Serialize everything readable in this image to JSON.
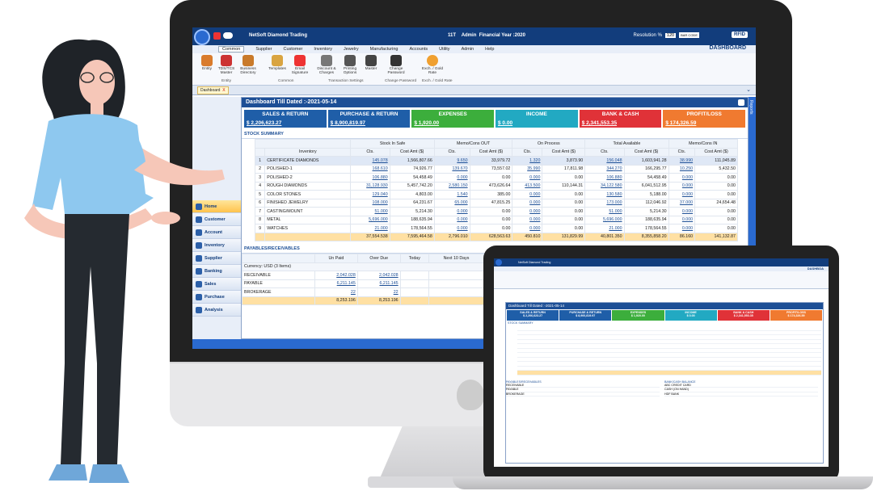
{
  "app": {
    "title": "NetSoft Diamond Trading",
    "user_info": "11T",
    "role": "Admin",
    "financial_year": "Financial Year :2020",
    "resolution_label": "Resolution %",
    "resolution_value": "120",
    "barcode_label": "BAR CODE",
    "rfid_label": "RFID",
    "dashboard_label": "DASHBOARD"
  },
  "menu": [
    "Common",
    "Supplier",
    "Customer",
    "Inventory",
    "Jewelry",
    "Manufacturing",
    "Accounts",
    "Utility",
    "Admin",
    "Help"
  ],
  "ribbon": {
    "items": [
      {
        "label": "Entity",
        "icon": "entity-icon"
      },
      {
        "label": "TDS/TCS Master",
        "icon": "tds-icon"
      },
      {
        "label": "Business Directory",
        "icon": "directory-icon"
      },
      {
        "label": "Templates",
        "icon": "templates-icon"
      },
      {
        "label": "Email Signature",
        "icon": "email-icon"
      },
      {
        "label": "Discount & Charges",
        "icon": "discount-icon"
      },
      {
        "label": "Printing Options",
        "icon": "printer-icon"
      },
      {
        "label": "Master",
        "icon": "master-icon"
      },
      {
        "label": "Change Password",
        "icon": "password-icon"
      },
      {
        "label": "Exch. / Gold Rate",
        "icon": "gold-rate-icon"
      }
    ],
    "groups": [
      "Entity",
      "Common",
      "Transaction Settings",
      "Change Password",
      "Exch. / Gold Rate"
    ]
  },
  "doc_tab": "Dashboard",
  "doc_tab_close": "X",
  "side_tab": "Reports",
  "nav": [
    "Home",
    "Customer",
    "Account",
    "Inventory",
    "Supplier",
    "Banking",
    "Sales",
    "Purchase",
    "Analysis"
  ],
  "dashboard": {
    "heading": "Dashboard Till Dated :-2021-05-14",
    "kpis": [
      {
        "title": "SALES & RETURN",
        "value": "$ 2,206,623.27",
        "color": "#1f5ea8"
      },
      {
        "title": "PURCHASE & RETURN",
        "value": "$ 8,900,819.97",
        "color": "#1f5ea8"
      },
      {
        "title": "EXPENSES",
        "value": "$ 1,920.00",
        "color": "#3cae3c"
      },
      {
        "title": "INCOME",
        "value": "$ 0.00",
        "color": "#22a9c2"
      },
      {
        "title": "BANK & CASH",
        "value": "$ 2,341,553.35",
        "color": "#e03238"
      },
      {
        "title": "PROFIT/LOSS",
        "value": "$ 174,326.59",
        "color": "#f07a30"
      }
    ],
    "stock_title": "STOCK SUMMARY",
    "stock_groups": [
      "Stock In Safe",
      "Memo/Cons OUT",
      "On Process",
      "Total Available",
      "Memo/Cons IN"
    ],
    "stock_subheads": [
      "Inventory",
      "Cts.",
      "Cost Amt ($)",
      "Cts.",
      "Cost Amt ($)",
      "Cts.",
      "Cost Amt ($)",
      "Cts.",
      "Cost Amt ($)",
      "Cts.",
      "Cost Amt ($)"
    ],
    "stock_rows": [
      [
        "1",
        "CERTIFICATE DIAMONDS",
        "145.078",
        "1,566,807.66",
        "9.650",
        "33,979.72",
        "1.320",
        "3,873.90",
        "156.048",
        "1,603,941.28",
        "38.990",
        "111,045.89"
      ],
      [
        "2",
        "POLISHED-1",
        "168.610",
        "74,926.77",
        "139.670",
        "73,557.02",
        "35.990",
        "17,811.98",
        "344.270",
        "166,295.77",
        "10.250",
        "5,432.50"
      ],
      [
        "3",
        "POLISHED-2",
        "106.880",
        "54,458.49",
        "0.000",
        "0.00",
        "0.000",
        "0.00",
        "106.880",
        "54,458.49",
        "0.000",
        "0.00"
      ],
      [
        "4",
        "ROUGH DIAMONDS",
        "31,128.930",
        "5,457,742.20",
        "2,580.150",
        "473,626.64",
        "413.500",
        "110,144.31",
        "34,122.580",
        "6,041,512.95",
        "0.000",
        "0.00"
      ],
      [
        "5",
        "COLOR STONES",
        "129.040",
        "4,803.00",
        "1.540",
        "385.00",
        "0.000",
        "0.00",
        "130.580",
        "5,188.00",
        "0.000",
        "0.00"
      ],
      [
        "6",
        "FINISHED JEWELRY",
        "108.000",
        "64,231.67",
        "65.000",
        "47,815.25",
        "0.000",
        "0.00",
        "173.000",
        "112,046.92",
        "37.000",
        "24,654.48"
      ],
      [
        "7",
        "CASTING/MOUNT",
        "51.000",
        "5,214.30",
        "0.000",
        "0.00",
        "0.000",
        "0.00",
        "51.000",
        "5,214.30",
        "0.000",
        "0.00"
      ],
      [
        "8",
        "METAL",
        "5,696.000",
        "188,635.94",
        "0.000",
        "0.00",
        "0.000",
        "0.00",
        "5,696.000",
        "188,635.94",
        "0.000",
        "0.00"
      ],
      [
        "9",
        "WATCHES",
        "21.000",
        "178,564.55",
        "0.000",
        "0.00",
        "0.000",
        "0.00",
        "21.000",
        "178,564.55",
        "0.000",
        "0.00"
      ]
    ],
    "stock_total": [
      "",
      "",
      "37,554.538",
      "7,595,464.58",
      "2,796.010",
      "628,563.63",
      "450.810",
      "131,829.99",
      "40,801.350",
      "8,355,858.20",
      "86.160",
      "141,132.87"
    ],
    "payables_title": "PAYABLES/RECEIVABLES",
    "pay_heads": [
      "Un Paid",
      "Over Due",
      "Today",
      "Next 10 Days"
    ],
    "pay_group": "Currency: USD (3 Items)",
    "pay_rows": [
      [
        "RECEIVABLE",
        "2,042.028",
        "2,042.028"
      ],
      [
        "PAYABLE",
        "6,211.145",
        "6,211.145"
      ],
      [
        "BROKERAGE",
        "22",
        "22"
      ]
    ],
    "pay_total": [
      "8,253.196",
      "8,253.196"
    ]
  },
  "laptop": {
    "title": "NetSoft Diamond Trading",
    "heading": "Dashboard Till Dated :-2021-05-14",
    "dashboard_label": "DASHBOA",
    "kpis": [
      {
        "title": "SALES & RETURN",
        "value": "$ 2,206,623.27",
        "color": "#1f5ea8"
      },
      {
        "title": "PURCHASE & RETURN",
        "value": "$ 8,900,819.97",
        "color": "#1f5ea8"
      },
      {
        "title": "EXPENSES",
        "value": "$ 1,920.00",
        "color": "#3cae3c"
      },
      {
        "title": "INCOME",
        "value": "$ 0.00",
        "color": "#22a9c2"
      },
      {
        "title": "BANK & CASH",
        "value": "$ 2,341,553.35",
        "color": "#e03238"
      },
      {
        "title": "PROFIT/LOSS",
        "value": "$ 174,326.59",
        "color": "#f07a30"
      }
    ],
    "stock_title": "STOCK SUMMARY",
    "payables_title": "PAYABLES/RECEIVABLES",
    "bank_title": "BANK/CASH BALANCE",
    "bank_rows": [
      "ABC CREDIT CARD",
      "CASH (ON HAND)",
      "HDF BANK"
    ],
    "pay_rows": [
      "RECEIVABLE",
      "PAYABLE",
      "BROKERAGE"
    ]
  }
}
